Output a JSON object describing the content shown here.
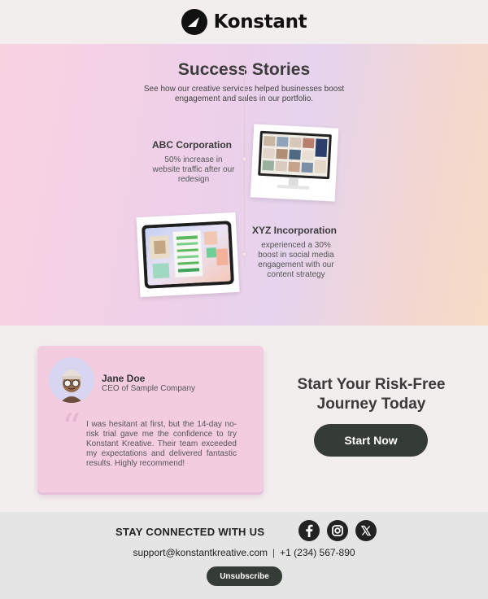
{
  "brand": {
    "name": "Konstant"
  },
  "stories": {
    "title": "Success Stories",
    "subtitle": "See how our creative services helped businesses boost engagement and sales in our portfolio.",
    "cases": [
      {
        "title": "ABC Corporation",
        "description": "50% increase in website traffic after our redesign"
      },
      {
        "title": "XYZ Incorporation",
        "description": "experienced a 30% boost in social media engagement with our content strategy"
      }
    ]
  },
  "testimonial": {
    "name": "Jane Doe",
    "role": "CEO of Sample Company",
    "quote": "I was hesitant at first, but the 14-day no-risk trial gave me the confidence to try Konstant Kreative. Their team exceeded my expectations and delivered fantastic results. Highly recommend!"
  },
  "cta": {
    "title": "Start Your Risk-Free Journey Today",
    "button": "Start Now"
  },
  "footer": {
    "stay_connected": "STAY CONNECTED WITH US",
    "social_icons": [
      "facebook-icon",
      "instagram-icon",
      "x-icon"
    ],
    "email": "support@konstantkreative.com",
    "separator": "|",
    "phone": "+1 (234) 567-890",
    "unsubscribe": "Unsubscribe"
  },
  "colors": {
    "dark_button": "#353b35",
    "card_pink": "#f4cce0",
    "background": "#f3eeee"
  }
}
